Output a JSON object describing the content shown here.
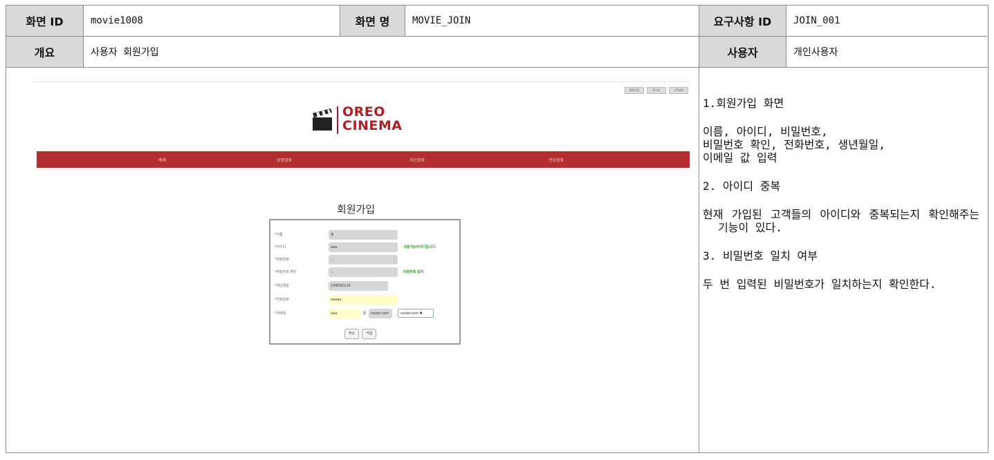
{
  "header": {
    "screen_id_label": "화면 ID",
    "screen_id": "movie1008",
    "screen_name_label": "화면 명",
    "screen_name": "MOVIE_JOIN",
    "req_id_label": "요구사항 ID",
    "req_id": "JOIN_001",
    "overview_label": "개요",
    "overview": "사용자 회원가입",
    "user_label": "사용자",
    "user": "개인사용자"
  },
  "mock": {
    "top_links": [
      "회원가입",
      "로그인",
      "고객센터"
    ],
    "brand_line1": "OREO",
    "brand_line2": "CINEMA",
    "nav": [
      "예매",
      "상영영화",
      "지난영화",
      "관심영화"
    ],
    "join_title": "회원가입",
    "fields": [
      {
        "label": "*이름",
        "value": "왕"
      },
      {
        "label": "*아이디",
        "value": "aaa",
        "status": "사용가능아이디입니다."
      },
      {
        "label": "*비밀번호",
        "value": "..."
      },
      {
        "label": "*비밀번호 확인",
        "value": "...",
        "status": "비밀번호 일치"
      },
      {
        "label": "*생년월일",
        "value": "1990/01/10"
      },
      {
        "label": "*전화번호",
        "value": "aaaaa"
      },
      {
        "label": "*이메일",
        "value": "aaa",
        "at": "@",
        "domain": "naver.com",
        "select": "naver.com ▼"
      }
    ],
    "cancel": "취소",
    "join": "가입",
    "colors": {
      "brand": "#b11e24",
      "nav": "#b32e2e",
      "ok": "#2a9d2a",
      "highlight": "#fdfdc8"
    }
  },
  "description": {
    "s1_title": "1.회원가입 화면",
    "s1_body_1": "이름, 아이디, 비밀번호,",
    "s1_body_2": "비밀번호 확인, 전화번호, 생년월일,",
    "s1_body_3": "이메일 값 입력",
    "s2_title": "2. 아이디 중복",
    "s2_body": "현재 가입된 고객들의 아이디와 중복되는지 확인해주는 기능이 있다.",
    "s3_title": "3. 비밀번호 일치 여부",
    "s3_body": "두 번 입력된 비밀번호가 일치하는지 확인한다."
  }
}
